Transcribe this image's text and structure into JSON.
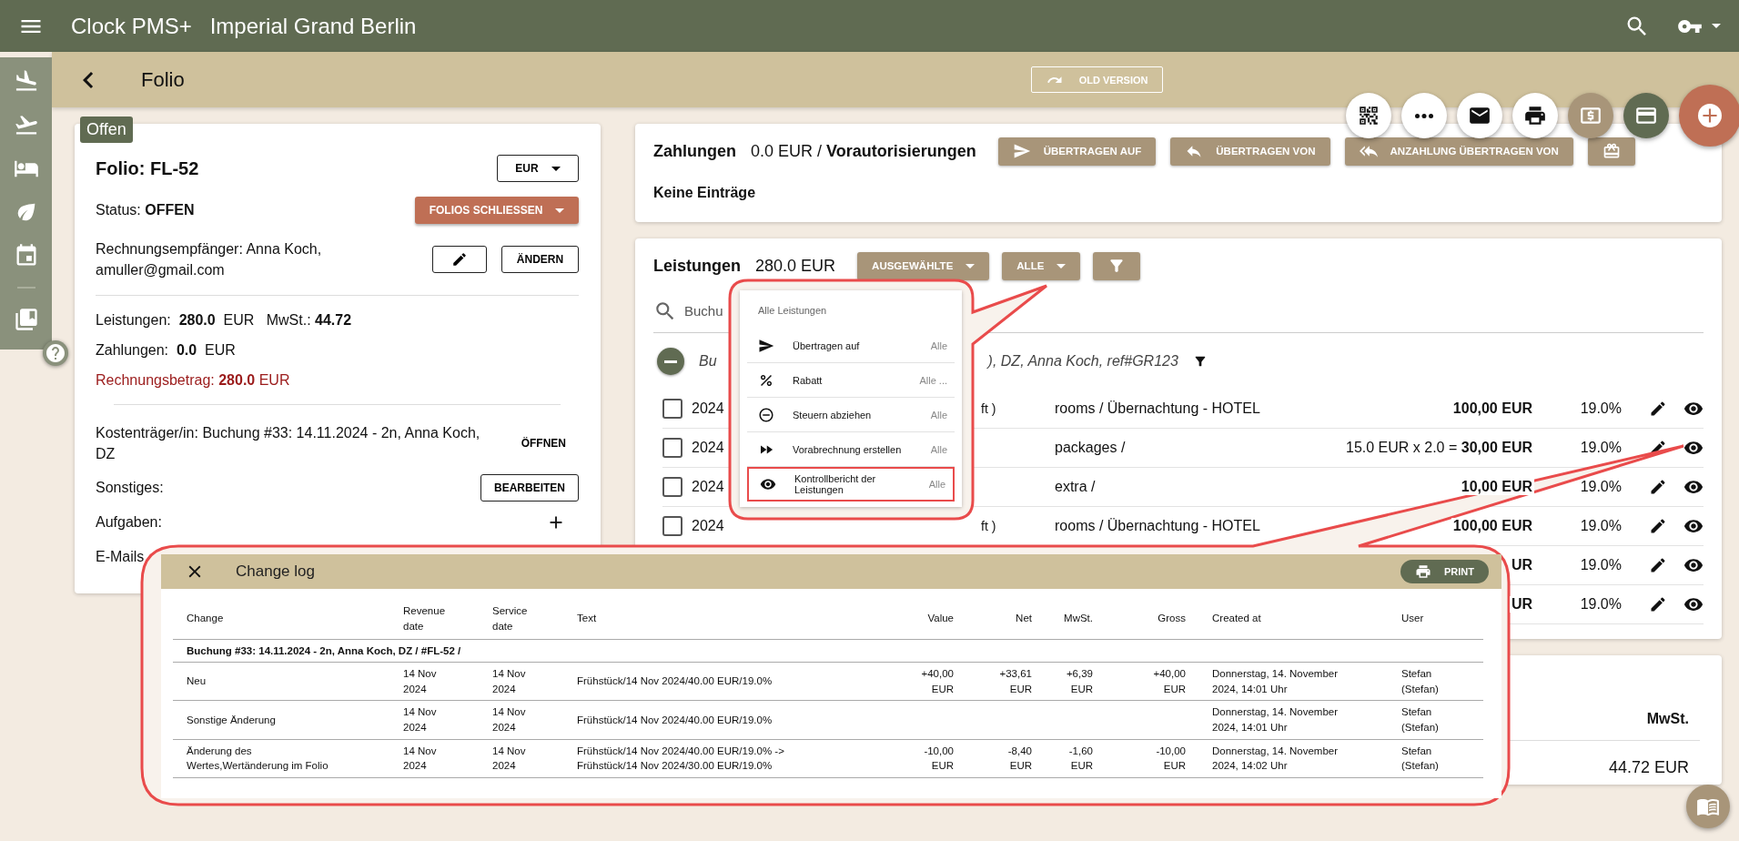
{
  "app_bar": {
    "title": "Clock PMS+",
    "hotel": "Imperial Grand Berlin"
  },
  "page": {
    "title": "Folio",
    "old_version_button": "OLD VERSION"
  },
  "folio": {
    "status_badge": "Offen",
    "title": "Folio: FL-52",
    "currency": "EUR",
    "status": "Status: **OFFEN**",
    "close_button": "FOLIOS SCHLIESSEN",
    "recipient": "Rechnungsempfänger: Anna Koch, amuller@gmail.com",
    "change_button": "ÄNDERN",
    "services": "Leistungen:  **280.0**  EUR   MwSt.: **44.72**",
    "payments": "Zahlungen:  **0.0**  EUR",
    "invoice": "Rechnungsbetrag: **280.0** EUR",
    "payer": "Kostenträger/in: Buchung #33: 14.11.2024 - 2n, Anna Koch, DZ",
    "open_button": "ÖFFNEN",
    "other_label": "Sonstiges:",
    "edit_button": "BEARBEITEN",
    "tasks_label": "Aufgaben:",
    "emails_label": "E-Mails"
  },
  "payments": {
    "title": "Zahlungen",
    "summary": "0.0 EUR / **Vorautorisierungen**",
    "buttons": [
      {
        "kind": "send",
        "label": "ÜBERTRAGEN AUF"
      },
      {
        "kind": "reply",
        "label": "ÜBERTRAGEN VON"
      },
      {
        "kind": "reply_all",
        "label": "ANZAHLUNG ÜBERTRAGEN VON"
      },
      {
        "kind": "gift"
      }
    ],
    "empty": "Keine Einträge"
  },
  "services": {
    "title": "Leistungen",
    "total": "280.0 EUR",
    "selected_button": "AUSGEWÄHLTE",
    "all_button": "ALLE",
    "search": {
      "placeholder": "Buchu"
    },
    "group": {
      "prefix": "Bu",
      "label": "), DZ, Anna Koch, ref#GR123",
      "expanded": true
    },
    "rows": [
      {
        "checked": false,
        "date": "2024",
        "detail": "ft )",
        "description": "rooms / Übernachtung - HOTEL",
        "amount": "**100,00 EUR**",
        "vat": "19.0%"
      },
      {
        "checked": false,
        "date": "2024",
        "description": "packages /",
        "amount": "15.0 EUR x 2.0 = **30,00 EUR**",
        "vat": "19.0%"
      },
      {
        "checked": false,
        "date": "2024",
        "description": "extra /",
        "amount": "**10,00 EUR**",
        "vat": "19.0%"
      },
      {
        "checked": false,
        "date": "2024",
        "detail": "ft )",
        "description": "rooms / Übernachtung - HOTEL",
        "amount": "**100,00 EUR**",
        "vat": "19.0%"
      },
      {
        "amount": "**UR**",
        "vat": "19.0%"
      },
      {
        "amount": "**UR**",
        "vat": "19.0%"
      }
    ]
  },
  "totals": {
    "column": "MwSt.",
    "value": "44.72 EUR"
  },
  "menu": {
    "title": "Alle Leistungen",
    "items": [
      {
        "kind": "send",
        "label": "Übertragen auf",
        "scope": "Alle",
        "highlighted": false
      },
      {
        "kind": "percent",
        "label": "Rabatt",
        "scope": "Alle ...",
        "highlighted": false
      },
      {
        "kind": "minus",
        "label": "Steuern abziehen",
        "scope": "Alle",
        "highlighted": false
      },
      {
        "kind": "forward",
        "label": "Vorabrechnung erstellen",
        "scope": "Alle",
        "highlighted": false
      },
      {
        "kind": "eye",
        "label": "Kontrollbericht der Leistungen",
        "scope": "Alle",
        "highlighted": true
      }
    ]
  },
  "change_log": {
    "title": "Change log",
    "print_button": "PRINT",
    "columns": [
      "Change",
      "Revenue\ndate",
      "Service\ndate",
      "Text",
      "Value",
      "Net",
      "MwSt.",
      "Gross",
      "Created at",
      "User"
    ],
    "group": "Buchung #33: 14.11.2024 - 2n, Anna Koch, DZ / #FL-52 /",
    "rows": [
      {
        "cells": [
          "Neu",
          "14 Nov\n2024",
          "14 Nov\n2024",
          "Frühstück/14 Nov 2024/40.00 EUR/19.0%",
          "+40,00\nEUR",
          "+33,61\nEUR",
          "+6,39\nEUR",
          "+40,00\nEUR",
          "Donnerstag, 14. November\n2024, 14:01 Uhr",
          "Stefan\n(Stefan)"
        ]
      },
      {
        "cells": [
          "Sonstige Änderung",
          "14 Nov\n2024",
          "14 Nov\n2024",
          "Frühstück/14 Nov 2024/40.00 EUR/19.0%",
          "",
          "",
          "",
          "",
          "Donnerstag, 14. November\n2024, 14:01 Uhr",
          "Stefan\n(Stefan)"
        ]
      },
      {
        "cells": [
          "Änderung des\nWertes,Wertänderung im Folio",
          "14 Nov\n2024",
          "14 Nov\n2024",
          "Frühstück/14 Nov 2024/40.00 EUR/19.0% ->\nFrühstück/14 Nov 2024/30.00 EUR/19.0%",
          "-10,00\nEUR",
          "-8,40\nEUR",
          "-1,60\nEUR",
          "-10,00\nEUR",
          "Donnerstag, 14. November\n2024, 14:02 Uhr",
          "Stefan\n(Stefan)"
        ]
      }
    ]
  }
}
